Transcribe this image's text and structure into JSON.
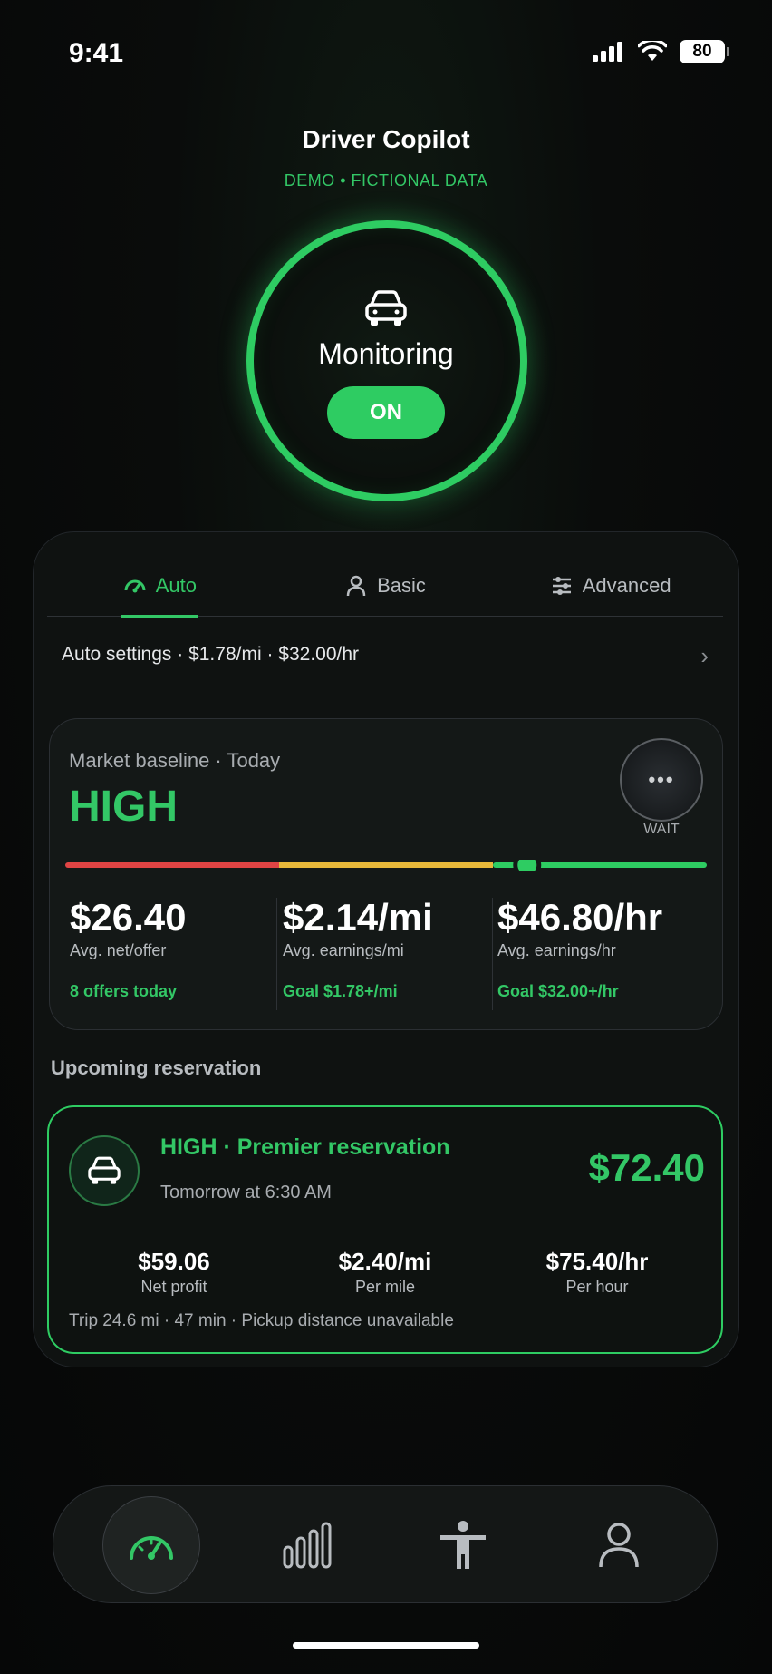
{
  "status_bar": {
    "time": "9:41",
    "battery": "80"
  },
  "header": {
    "title": "Driver Copilot",
    "tag": "DEMO • FICTIONAL DATA"
  },
  "monitor": {
    "label": "Monitoring",
    "state": "ON"
  },
  "tabs": [
    {
      "label": "Auto",
      "icon": "gauge-icon",
      "active": true
    },
    {
      "label": "Basic",
      "icon": "person-icon",
      "active": false
    },
    {
      "label": "Advanced",
      "icon": "sliders-icon",
      "active": false
    }
  ],
  "auto_settings": {
    "text": "Auto settings · $1.78/mi · $32.00/hr"
  },
  "market": {
    "label": "Market baseline · Today",
    "level": "HIGH",
    "action": "WAIT",
    "action_dots": "•••",
    "gauge_position": 0.72,
    "gauge_colors": {
      "low": "#e04444",
      "mid": "#e8b83a",
      "high": "#2ecc62"
    },
    "metrics": [
      {
        "value": "$26.40",
        "sub": "Avg. net/offer",
        "goal": "8 offers today"
      },
      {
        "value": "$2.14/mi",
        "sub": "Avg. earnings/mi",
        "goal": "Goal $1.78+/mi"
      },
      {
        "value": "$46.80/hr",
        "sub": "Avg. earnings/hr",
        "goal": "Goal $32.00+/hr"
      }
    ]
  },
  "upcoming": {
    "heading": "Upcoming reservation",
    "title": "HIGH  ·  Premier reservation",
    "time": "Tomorrow at 6:30 AM",
    "price": "$72.40",
    "stats": [
      {
        "value": "$59.06",
        "label": "Net profit"
      },
      {
        "value": "$2.40/mi",
        "label": "Per mile"
      },
      {
        "value": "$75.40/hr",
        "label": "Per hour"
      }
    ],
    "footer": "Trip 24.6 mi · 47 min · Pickup distance unavailable"
  },
  "nav": [
    {
      "icon": "speedometer-icon",
      "active": true
    },
    {
      "icon": "bar-chart-icon",
      "active": false
    },
    {
      "icon": "accessibility-icon",
      "active": false
    },
    {
      "icon": "profile-icon",
      "active": false
    }
  ],
  "colors": {
    "accent": "#2ecc62",
    "background": "#0a0c0b"
  }
}
